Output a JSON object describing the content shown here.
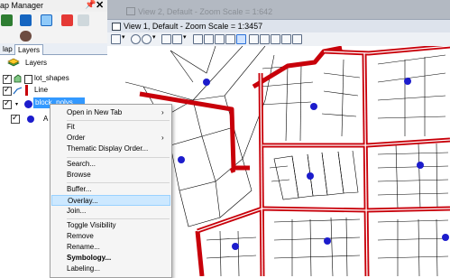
{
  "left_panel": {
    "title": "ap Manager",
    "pin_glyph": "📌",
    "close_glyph": "✕",
    "tabs": [
      "lap",
      "Layers"
    ],
    "tree": {
      "root": "Layers",
      "layers": [
        "lot_shapes",
        "Line",
        "block_polys"
      ],
      "sub_label": "A"
    }
  },
  "map": {
    "view2_title": "View 2, Default - Zoom Scale = 1:642",
    "view1_title": "View 1, Default - Zoom Scale = 1:3457",
    "colors": {
      "road": "#c8000a",
      "point": "#1c1ccc",
      "lot_line": "#000000"
    }
  },
  "context_menu": {
    "items": [
      {
        "label": "Open in New Tab",
        "submenu": true
      },
      {
        "label": "Fit"
      },
      {
        "label": "Order",
        "submenu": true
      },
      {
        "label": "Thematic Display Order..."
      },
      {
        "label": "Search..."
      },
      {
        "label": "Browse"
      },
      {
        "label": "Buffer..."
      },
      {
        "label": "Overlay...",
        "highlighted": true
      },
      {
        "label": "Join..."
      },
      {
        "label": "Toggle Visibility"
      },
      {
        "label": "Remove"
      },
      {
        "label": "Rename..."
      },
      {
        "label": "Symbology...",
        "bold": true
      },
      {
        "label": "Labeling..."
      }
    ],
    "submenu_glyph": "›"
  }
}
